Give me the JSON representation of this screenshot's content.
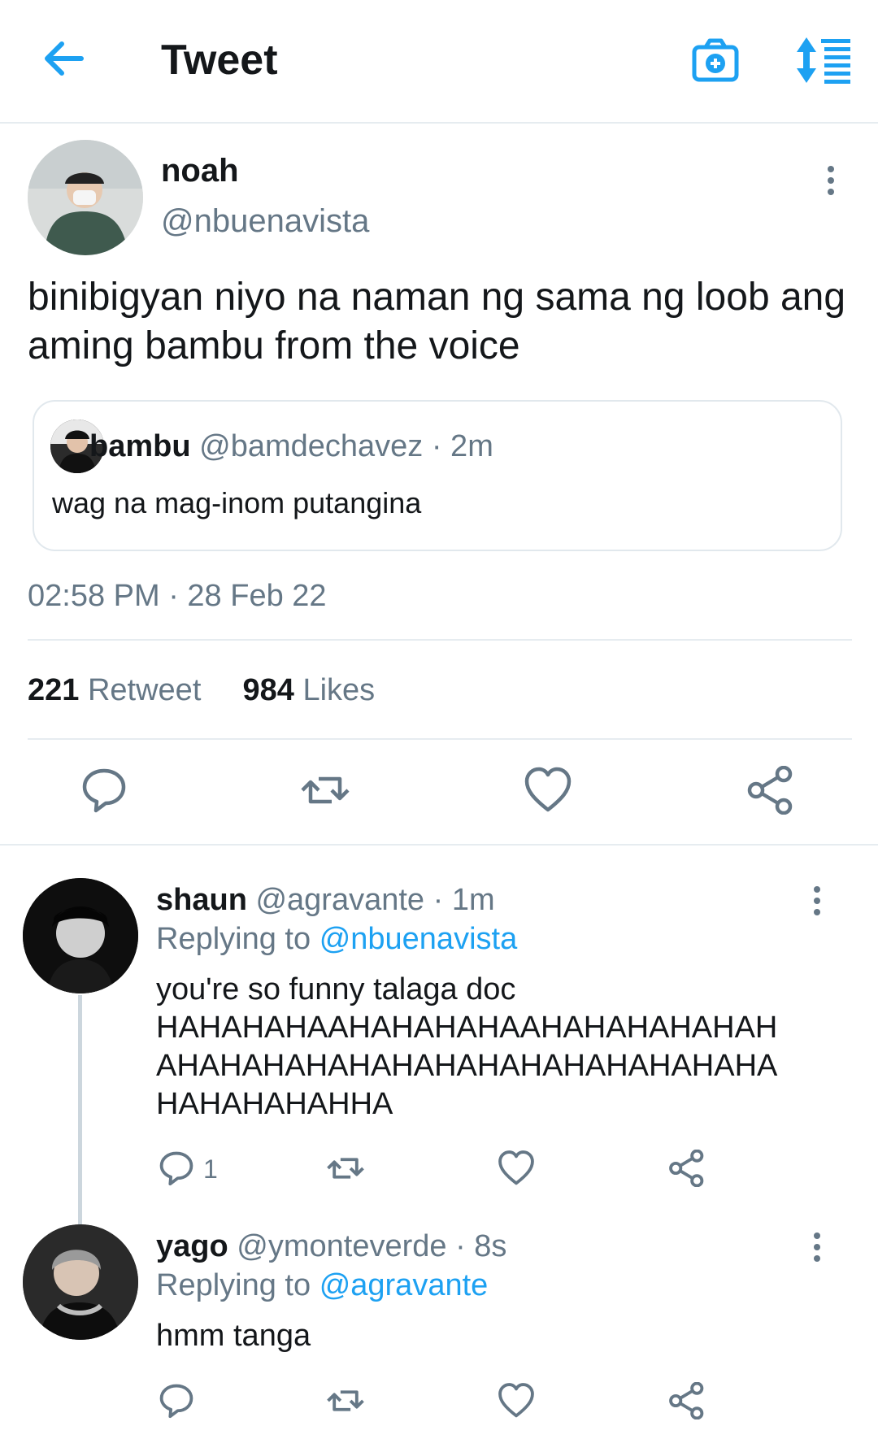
{
  "header": {
    "title": "Tweet",
    "icons": [
      "back-arrow-icon",
      "camera-plus-icon",
      "sort-icon"
    ]
  },
  "tweet": {
    "name": "noah",
    "handle": "@nbuenavista",
    "text": "binibigyan niyo na naman ng sama ng loob ang aming bambu from the voice",
    "quote": {
      "name": "bambu",
      "handle_time": "@bamdechavez · 2m",
      "text": "wag na mag-inom putangina"
    },
    "timestamp": "02:58 PM · 28 Feb 22",
    "retweets": "221",
    "retweets_label": "Retweet",
    "likes": "984",
    "likes_label": "Likes"
  },
  "replies": [
    {
      "name": "shaun",
      "handle_time": "@agravante · 1m",
      "replying_prefix": "Replying to",
      "replying_to": "@nbuenavista",
      "text_line1": "you're so funny talaga doc",
      "text_line2": "HAHAHAHAAHAHAHAHAAHAHAHAHAHAH",
      "text_line3": "AHAHAHAHAHAHAHAHAHAHAHAHAHAHA",
      "text_line4": "HAHAHAHAHHA",
      "reply_count": "1"
    },
    {
      "name": "yago",
      "handle_time": "@ymonteverde · 8s",
      "replying_prefix": "Replying to",
      "replying_to": "@agravante",
      "text": "hmm tanga"
    }
  ],
  "colors": {
    "accent": "#1da1f2",
    "muted": "#657786",
    "divider": "#e6ecf0"
  }
}
